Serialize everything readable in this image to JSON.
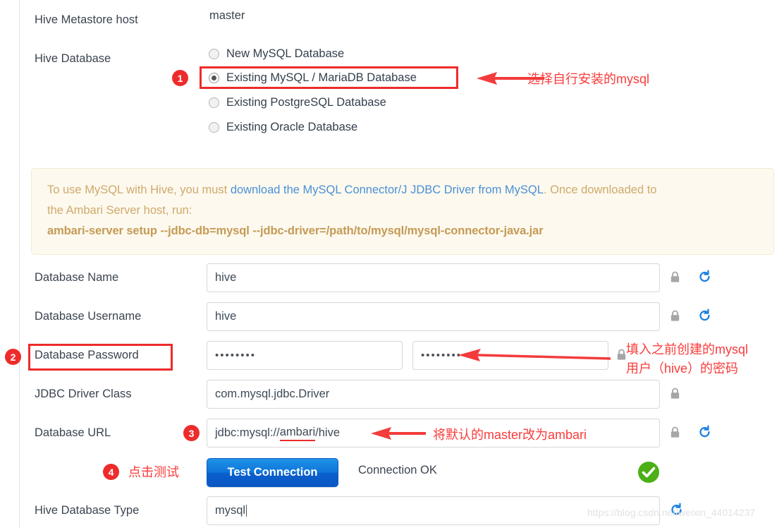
{
  "fields": {
    "metastore_host": {
      "label": "Hive Metastore host",
      "value": "master"
    },
    "hive_database": {
      "label": "Hive Database"
    },
    "database_name": {
      "label": "Database Name",
      "value": "hive"
    },
    "database_username": {
      "label": "Database Username",
      "value": "hive"
    },
    "database_password": {
      "label": "Database Password",
      "value": "••••••••",
      "confirm_value": "••••••••"
    },
    "jdbc_driver_class": {
      "label": "JDBC Driver Class",
      "value": "com.mysql.jdbc.Driver"
    },
    "database_url": {
      "label": "Database URL",
      "value_prefix": "jdbc:mysql://",
      "value_highlight": "ambari",
      "value_suffix": "/hive"
    },
    "hive_database_type": {
      "label": "Hive Database Type",
      "value": "mysql"
    }
  },
  "radio_options": [
    {
      "label": "New MySQL Database",
      "selected": false
    },
    {
      "label": "Existing MySQL / MariaDB Database",
      "selected": true
    },
    {
      "label": "Existing PostgreSQL Database",
      "selected": false
    },
    {
      "label": "Existing Oracle Database",
      "selected": false
    }
  ],
  "infobox": {
    "line1_pre": "To use MySQL with Hive, you must ",
    "line1_link": "download the MySQL Connector/J JDBC Driver from MySQL",
    "line1_post": ". Once downloaded to",
    "line2": "the Ambari Server host, run:",
    "command": "ambari-server setup --jdbc-db=mysql --jdbc-driver=/path/to/mysql/mysql-connector-java.jar"
  },
  "actions": {
    "test_connection_label": "Test Connection",
    "connection_status": "Connection OK",
    "status_icon": "check-circle-icon"
  },
  "annotations": {
    "badge1": "1",
    "badge2": "2",
    "badge3": "3",
    "badge4": "4",
    "note1": "选择自行安装的mysql",
    "note2_line1": "填入之前创建的mysql",
    "note2_line2": "用户（hive）的密码",
    "note3": "将默认的master改为ambari",
    "note4": "点击测试"
  },
  "icons": {
    "lock": "lock-icon",
    "refresh": "refresh-icon"
  },
  "watermark": "https://blog.csdn.net/weixin_44014237",
  "colors": {
    "annotation_red": "#ee2b2b",
    "button_blue": "#0e74d8",
    "link_blue": "#4a90d6",
    "info_bg": "#fdf9ee",
    "info_text": "#cfa96d",
    "success_green": "#4caf16"
  }
}
